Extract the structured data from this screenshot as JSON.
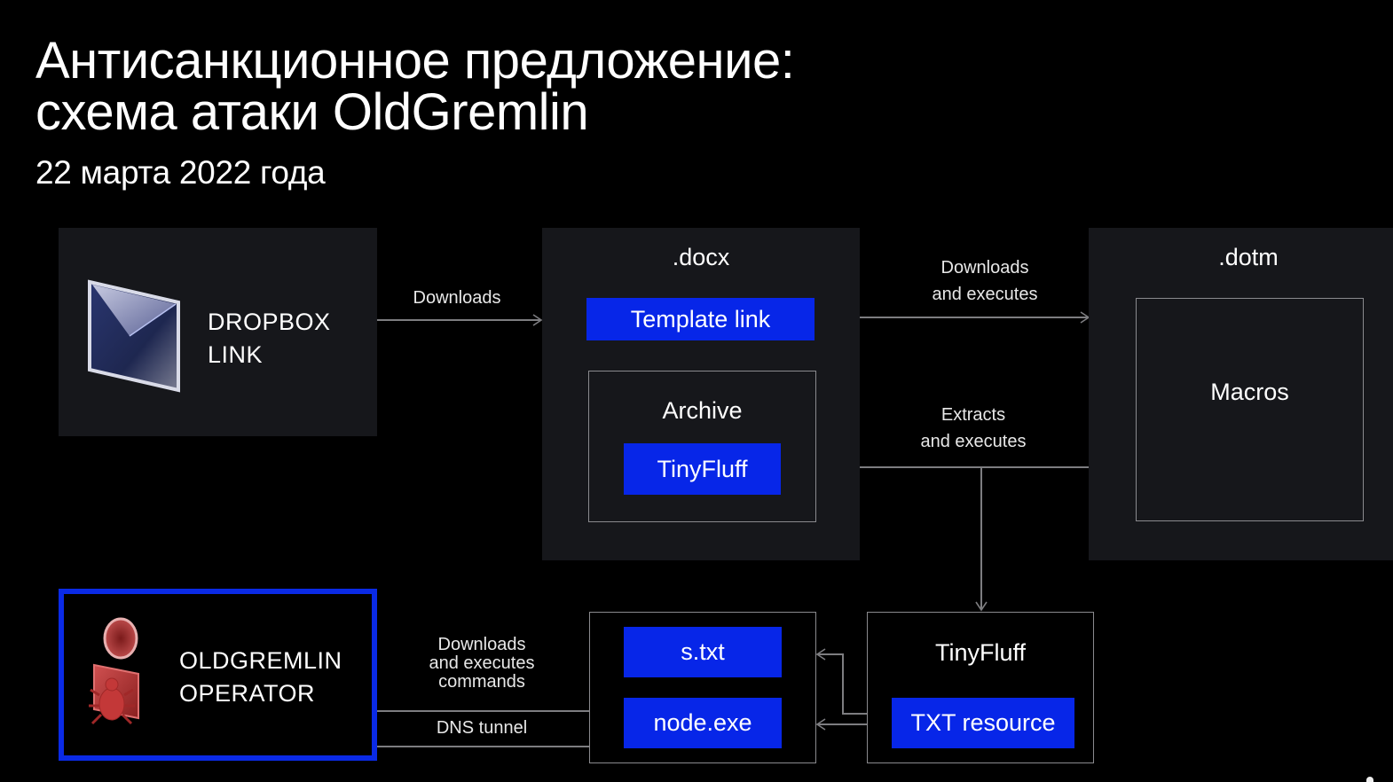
{
  "slide": {
    "title_line1": "Антисанкционное предложение:",
    "title_line2": "схема атаки OldGremlin",
    "subtitle": "22 марта 2022 года"
  },
  "nodes": {
    "dropbox": {
      "line1": "DROPBOX",
      "line2": "LINK",
      "icon": "envelope-icon"
    },
    "docx": {
      "title": ".docx",
      "template_link": "Template link",
      "archive": {
        "title": "Archive",
        "item": "TinyFluff"
      }
    },
    "dotm": {
      "title": ".dotm",
      "inner": "Macros"
    },
    "operator": {
      "line1": "OLDGREMLIN",
      "line2": "OPERATOR",
      "icon": "hacker-user-icon"
    },
    "payloads": {
      "items": [
        "s.txt",
        "node.exe"
      ]
    },
    "tinyfluff": {
      "title": "TinyFluff",
      "resource": "TXT resource"
    }
  },
  "edges": {
    "dropbox_to_docx": "Downloads",
    "template_to_dotm": {
      "line1": "Downloads",
      "line2": "and executes"
    },
    "macros_to_tinyfluff": {
      "line1": "Extracts",
      "line2": "and executes"
    },
    "operator_commands": {
      "line1": "Downloads",
      "line2": "and executes",
      "line3": "commands"
    },
    "dns": "DNS tunnel"
  },
  "colors": {
    "background": "#000000",
    "panel": "#16171b",
    "accent_blue": "#0726e8",
    "wire": "#7d7d80",
    "operator_border": "#0a2ae6"
  }
}
